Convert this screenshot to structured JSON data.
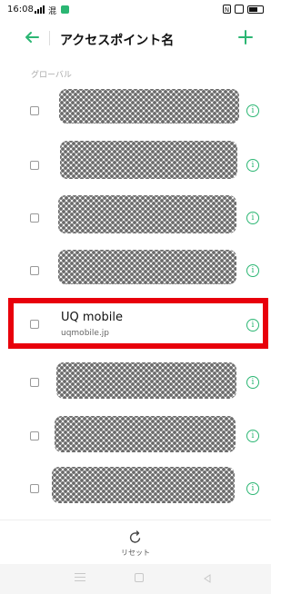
{
  "status_bar": {
    "time": "16:08",
    "sim_label": "混",
    "nfc": "N"
  },
  "header": {
    "title": "アクセスポイント名"
  },
  "section": {
    "label": "グローバル"
  },
  "apn_entries": [
    {
      "name": "",
      "apn": "",
      "redacted": true
    },
    {
      "name": "",
      "apn": "",
      "redacted": true
    },
    {
      "name": "",
      "apn": "",
      "redacted": true
    },
    {
      "name": "",
      "apn": "",
      "redacted": true
    },
    {
      "name": "UQ mobile",
      "apn": "uqmobile.jp",
      "redacted": false
    },
    {
      "name": "",
      "apn": "",
      "redacted": true
    },
    {
      "name": "",
      "apn": "",
      "redacted": true
    },
    {
      "name": "",
      "apn": "",
      "redacted": true
    }
  ],
  "footer": {
    "reset_label": "リセット"
  },
  "colors": {
    "accent": "#2bb673",
    "highlight": "#e8000b"
  }
}
